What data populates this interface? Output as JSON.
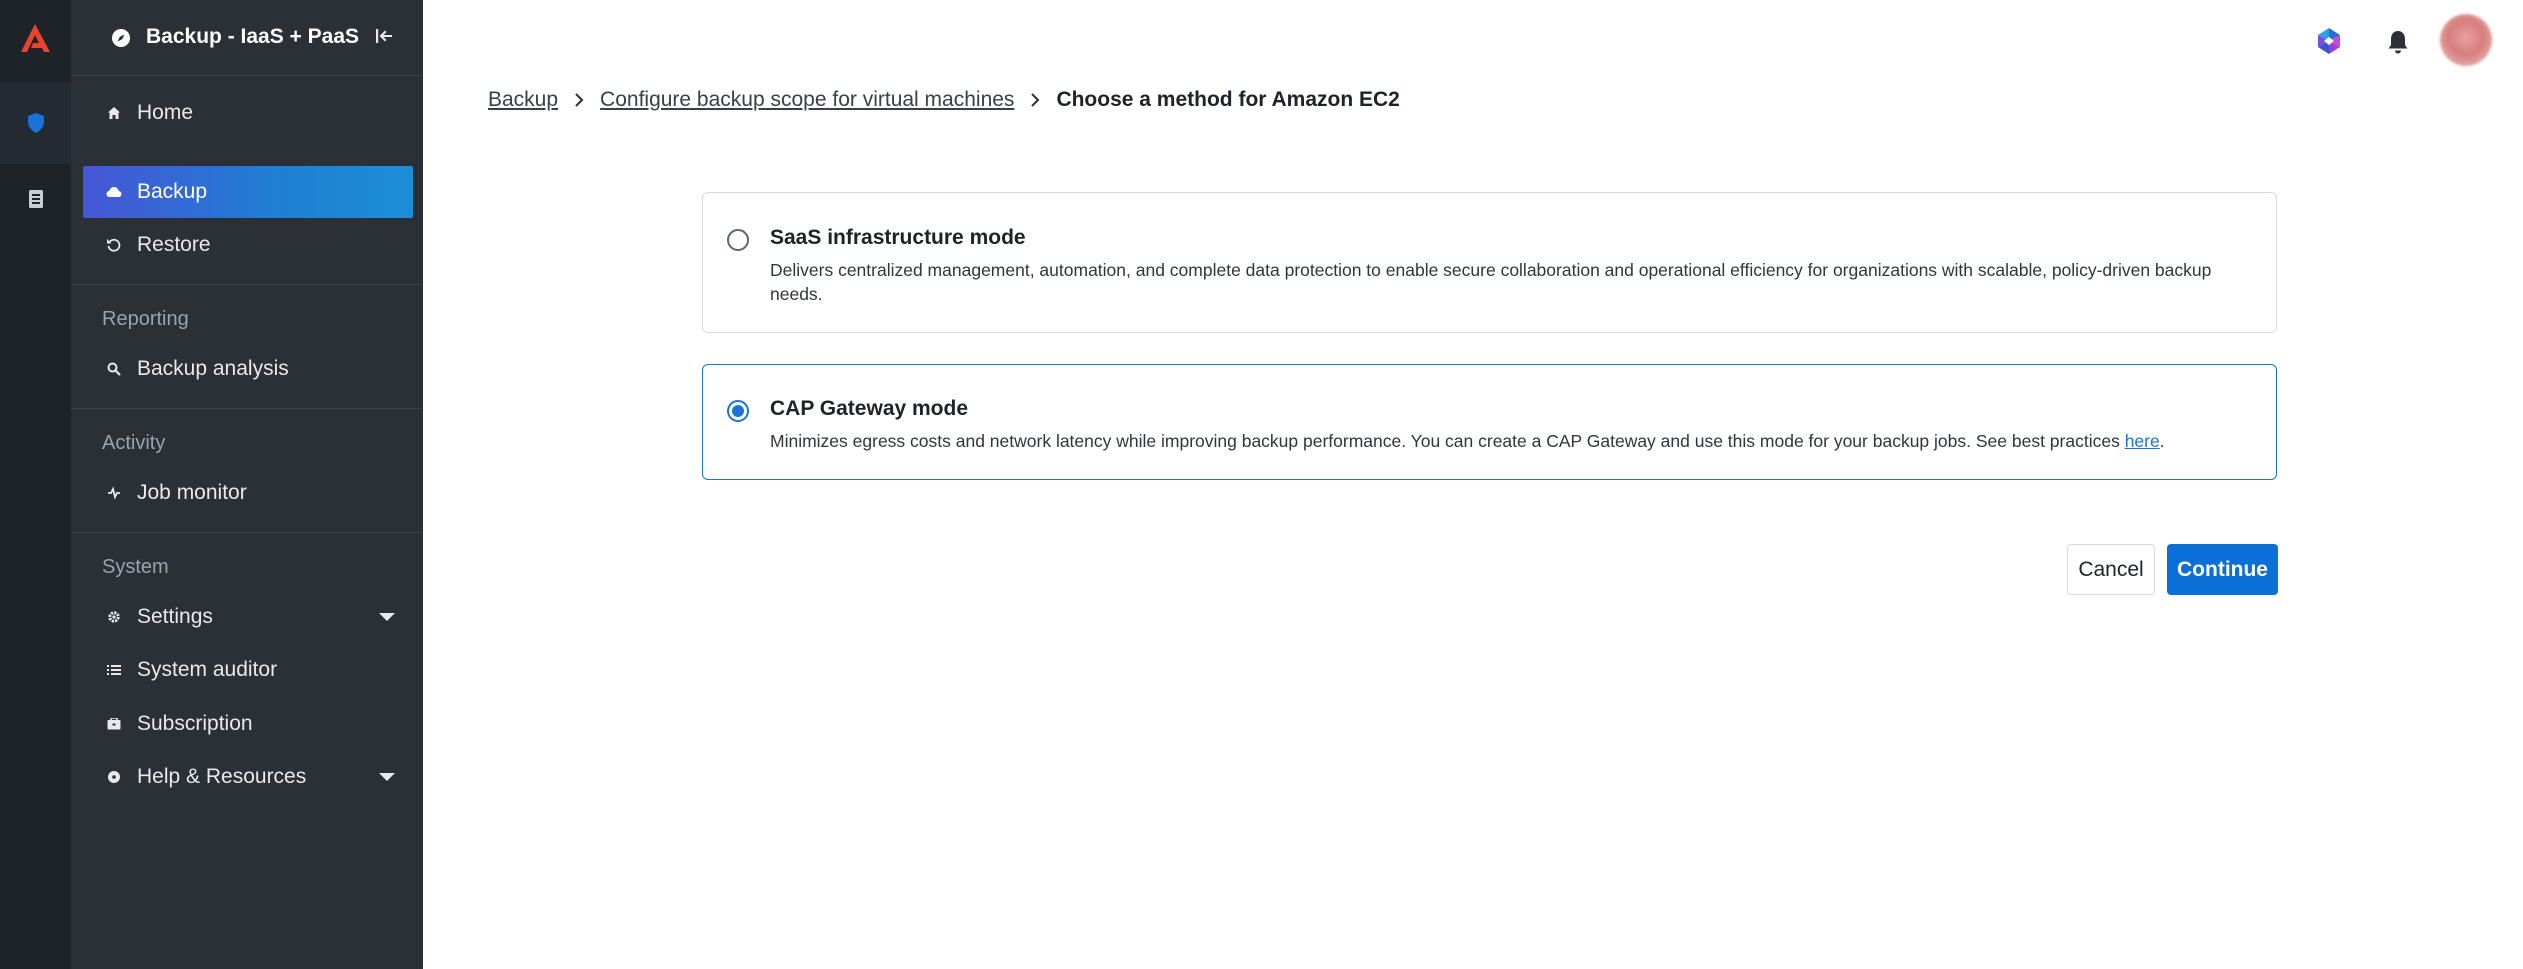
{
  "colors": {
    "accent": "#1a73d6",
    "rail": "#1d2329",
    "sidebar": "#2b3036",
    "logo": "#e8432e"
  },
  "sidebar": {
    "title": "Backup - IaaS + PaaS",
    "items": [
      {
        "label": "Home",
        "icon": "home-icon"
      },
      {
        "label": "Backup",
        "icon": "cloud-icon",
        "active": true
      },
      {
        "label": "Restore",
        "icon": "restore-icon"
      }
    ],
    "sections": [
      {
        "label": "Reporting",
        "items": [
          {
            "label": "Backup analysis",
            "icon": "search-icon"
          }
        ]
      },
      {
        "label": "Activity",
        "items": [
          {
            "label": "Job monitor",
            "icon": "activity-icon"
          }
        ]
      },
      {
        "label": "System",
        "items": [
          {
            "label": "Settings",
            "icon": "gear-icon",
            "expandable": true
          },
          {
            "label": "System auditor",
            "icon": "list-icon"
          },
          {
            "label": "Subscription",
            "icon": "subscription-icon"
          },
          {
            "label": "Help & Resources",
            "icon": "help-icon",
            "expandable": true
          }
        ]
      }
    ]
  },
  "breadcrumb": {
    "items": [
      "Backup",
      "Configure backup scope for virtual machines"
    ],
    "current": "Choose a method for Amazon EC2"
  },
  "options": [
    {
      "title": "SaaS infrastructure mode",
      "description": "Delivers centralized management, automation, and complete data protection to enable secure collaboration and operational efficiency for organizations with scalable, policy-driven backup needs.",
      "selected": false
    },
    {
      "title": "CAP Gateway mode",
      "description": "Minimizes egress costs and network latency while improving backup performance. You can create a CAP Gateway and use this mode for your backup jobs. See best practices ",
      "link_text": "here",
      "suffix": ".",
      "selected": true
    }
  ],
  "actions": {
    "cancel": "Cancel",
    "continue": "Continue"
  }
}
